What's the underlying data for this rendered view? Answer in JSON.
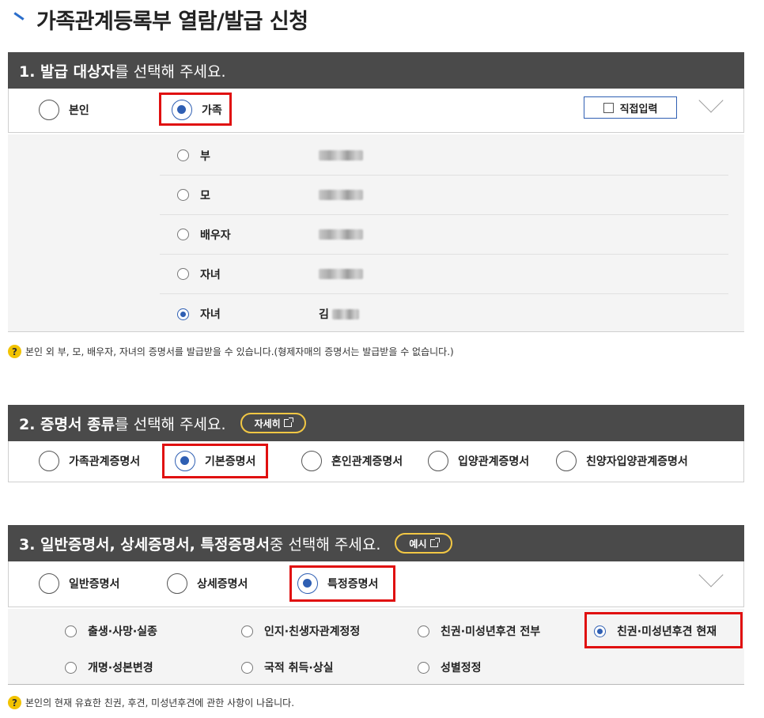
{
  "page": {
    "title": "가족관계등록부 열람/발급 신청"
  },
  "section1": {
    "header_strong": "1. 발급 대상자",
    "header_rest": "를 선택해 주세요.",
    "options": [
      {
        "label": "본인",
        "selected": false
      },
      {
        "label": "가족",
        "selected": true
      }
    ],
    "direct_input_label": "직접입력",
    "family": [
      {
        "relation": "부",
        "selected": false,
        "name": ""
      },
      {
        "relation": "모",
        "selected": false,
        "name": ""
      },
      {
        "relation": "배우자",
        "selected": false,
        "name": ""
      },
      {
        "relation": "자녀",
        "selected": false,
        "name": ""
      },
      {
        "relation": "자녀",
        "selected": true,
        "name": "김"
      }
    ],
    "help": "본인 외 부, 모, 배우자, 자녀의 증명서를 발급받을 수 있습니다.(형제자매의 증명서는 발급받을 수 없습니다.)"
  },
  "section2": {
    "header_strong": "2. 증명서 종류",
    "header_rest": "를 선택해 주세요.",
    "detail_button": "자세히",
    "options": [
      {
        "label": "가족관계증명서",
        "selected": false
      },
      {
        "label": "기본증명서",
        "selected": true
      },
      {
        "label": "혼인관계증명서",
        "selected": false
      },
      {
        "label": "입양관계증명서",
        "selected": false
      },
      {
        "label": "친양자입양관계증명서",
        "selected": false
      }
    ]
  },
  "section3": {
    "header_strong": "3. 일반증명서, 상세증명서, 특정증명서",
    "header_rest": " 중 선택해 주세요.",
    "example_button": "예시",
    "options": [
      {
        "label": "일반증명서",
        "selected": false
      },
      {
        "label": "상세증명서",
        "selected": false
      },
      {
        "label": "특정증명서",
        "selected": true
      }
    ],
    "special": [
      {
        "label": "출생·사망·실종",
        "selected": false
      },
      {
        "label": "인지·친생자관계정정",
        "selected": false
      },
      {
        "label": "친권·미성년후견 전부",
        "selected": false
      },
      {
        "label": "친권·미성년후견 현재",
        "selected": true
      },
      {
        "label": "개명·성본변경",
        "selected": false
      },
      {
        "label": "국적 취득·상실",
        "selected": false
      },
      {
        "label": "성별정정",
        "selected": false
      }
    ],
    "help": "본인의 현재 유효한 친권, 후견, 미성년후견에 관한 사항이 나옵니다."
  },
  "colors": {
    "header_bg": "#4a4a4a",
    "accent_blue": "#2f5fb3",
    "highlight_red": "#e01010",
    "pill_border": "#f2c744",
    "help_icon": "#f2c300"
  },
  "icons": {
    "title_mark": "title-slash-icon",
    "help": "question-circle-icon",
    "external": "external-link-icon",
    "chevron": "chevron-down-icon"
  }
}
